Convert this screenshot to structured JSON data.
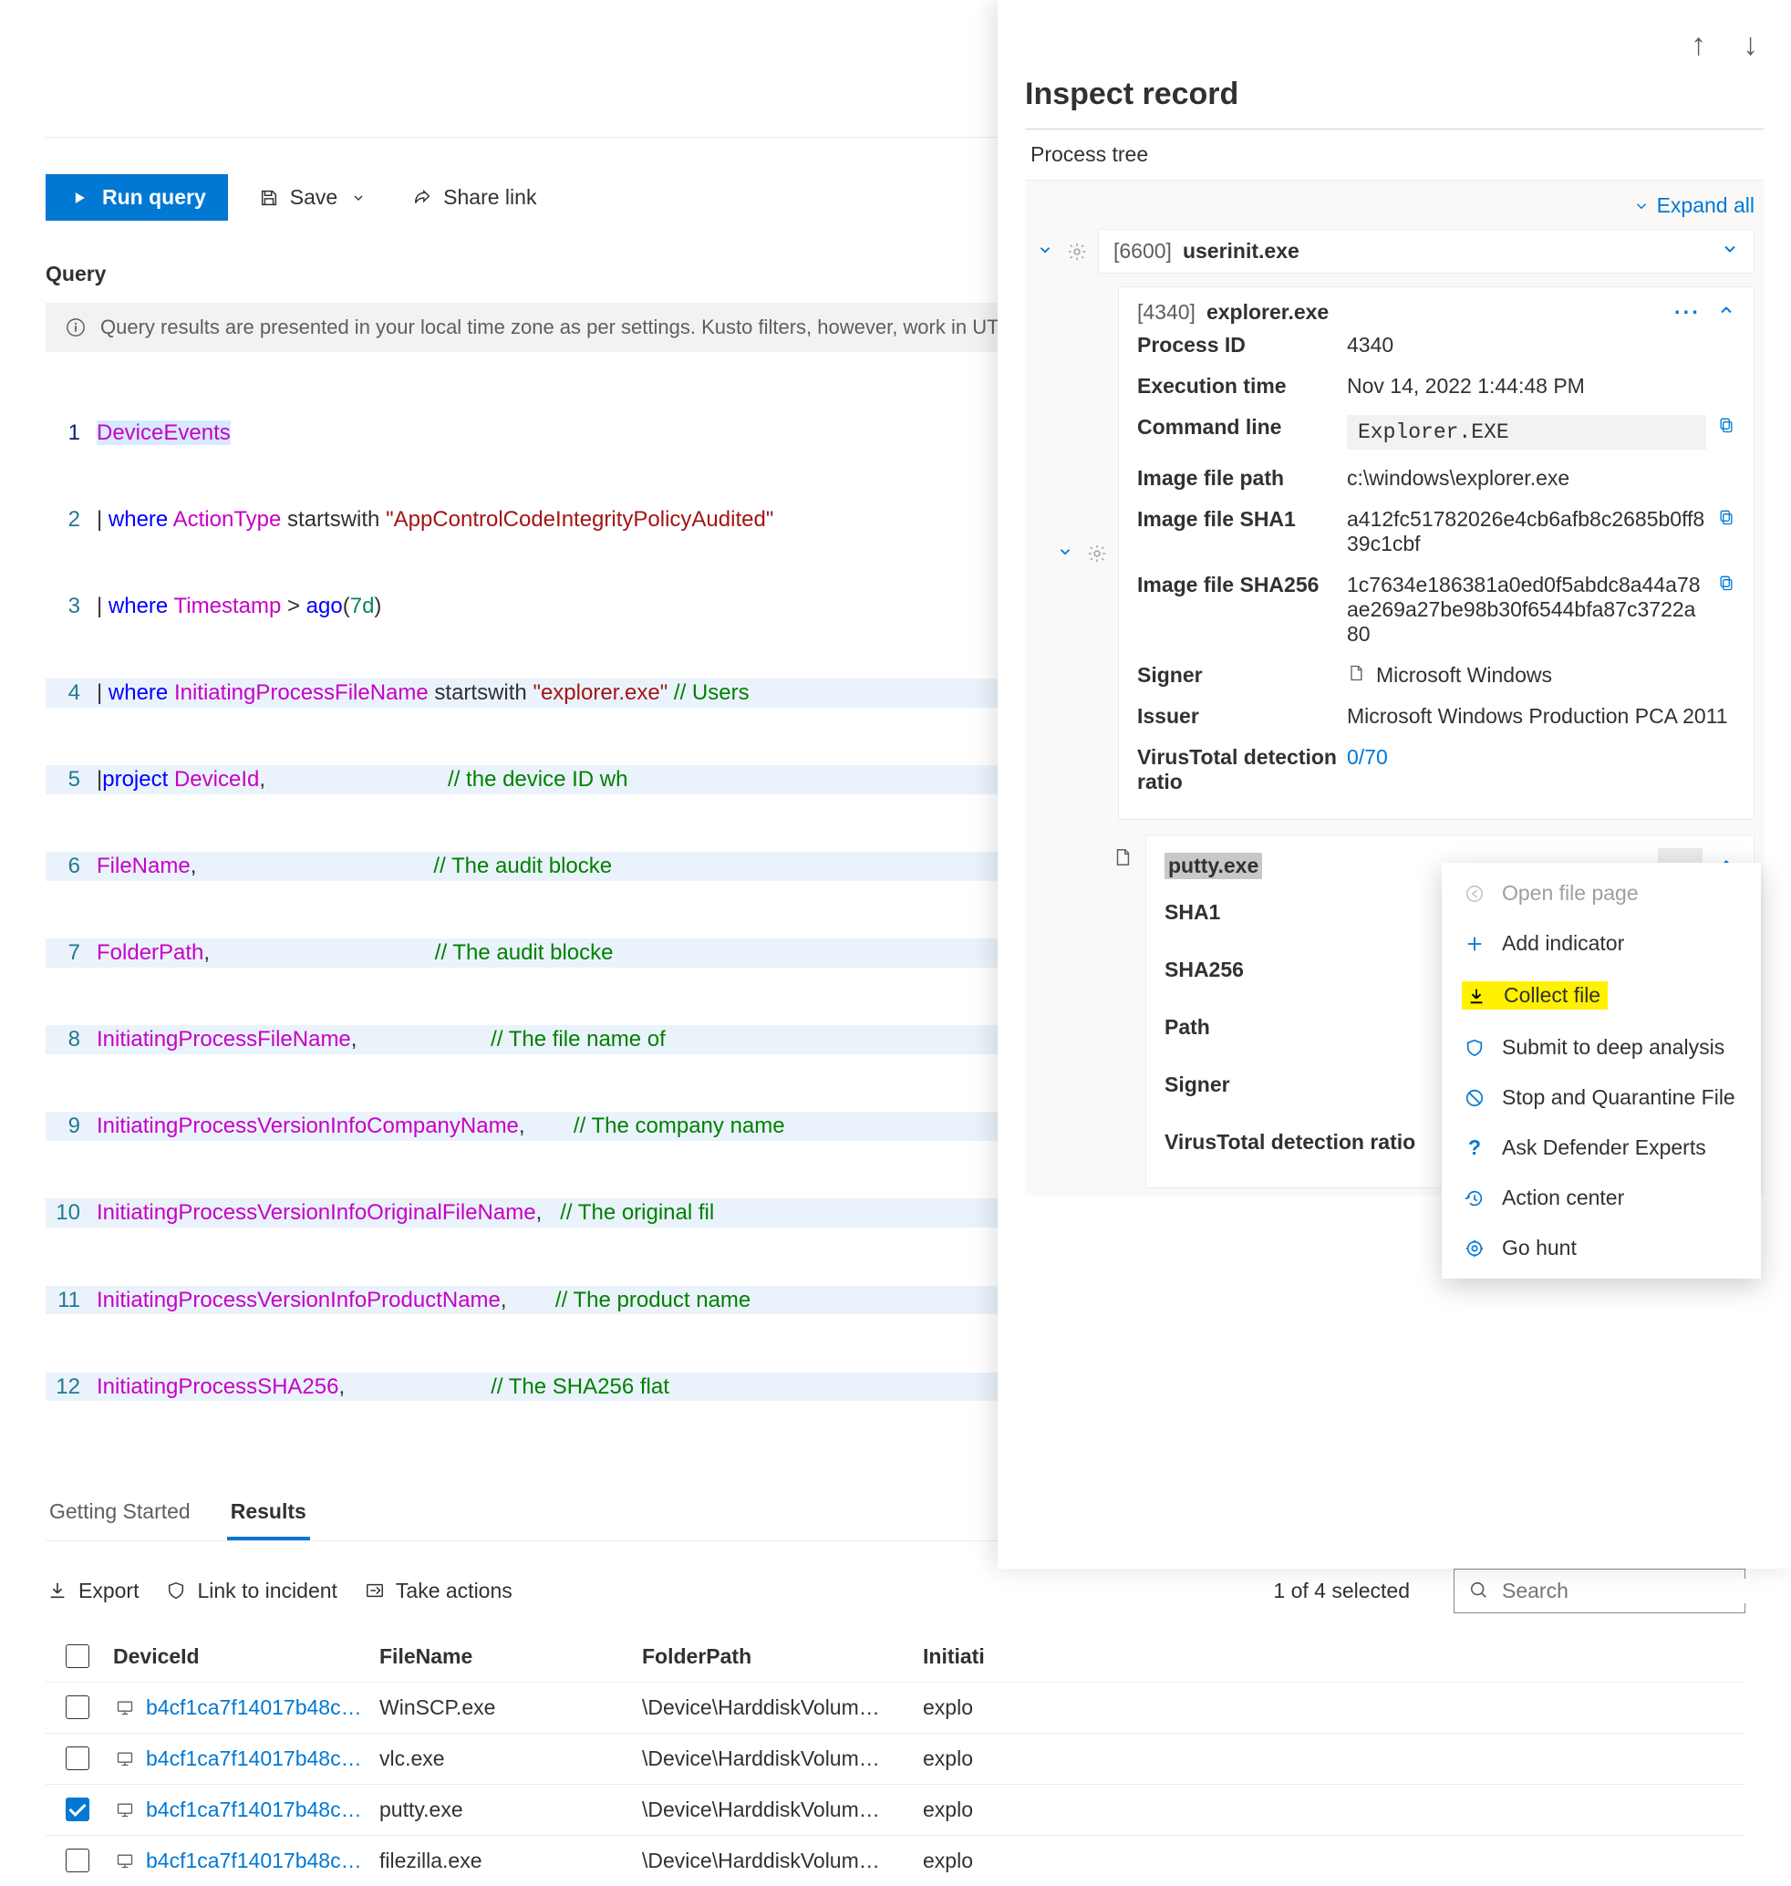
{
  "toolbar": {
    "run": "Run query",
    "save": "Save",
    "share": "Share link"
  },
  "query_label": "Query",
  "info_bar": "Query results are presented in your local time zone as per settings. Kusto filters, however, work in UTC.",
  "code": {
    "lines": [
      "DeviceEvents",
      "| where ActionType startswith \"AppControlCodeIntegrityPolicyAudited\"",
      "| where Timestamp > ago(7d)",
      "| where InitiatingProcessFileName startswith \"explorer.exe\" // Users",
      "|project DeviceId,                              // the device ID wh",
      "FileName,                                       // The audit blocke",
      "FolderPath,                                     // The audit blocke",
      "InitiatingProcessFileName,                      // The file name of",
      "InitiatingProcessVersionInfoCompanyName,        // The company name",
      "InitiatingProcessVersionInfoOriginalFileName,   // The original fil",
      "InitiatingProcessVersionInfoProductName,        // The product name",
      "InitiatingProcessSHA256,                        // The SHA256 flat "
    ]
  },
  "tabs": {
    "getting_started": "Getting Started",
    "results": "Results"
  },
  "results_toolbar": {
    "export": "Export",
    "link_incident": "Link to incident",
    "take_actions": "Take actions",
    "selected": "1 of 4 selected",
    "search_placeholder": "Search"
  },
  "table": {
    "headers": {
      "device": "DeviceId",
      "file": "FileName",
      "folder": "FolderPath",
      "init": "Initiati"
    },
    "rows": [
      {
        "selected": false,
        "device": "b4cf1ca7f14017b48c…",
        "file": "WinSCP.exe",
        "folder": "\\Device\\HarddiskVolum…",
        "init": "explo"
      },
      {
        "selected": false,
        "device": "b4cf1ca7f14017b48c…",
        "file": "vlc.exe",
        "folder": "\\Device\\HarddiskVolum…",
        "init": "explo"
      },
      {
        "selected": true,
        "device": "b4cf1ca7f14017b48c…",
        "file": "putty.exe",
        "folder": "\\Device\\HarddiskVolum…",
        "init": "explo"
      },
      {
        "selected": false,
        "device": "b4cf1ca7f14017b48c…",
        "file": "filezilla.exe",
        "folder": "\\Device\\HarddiskVolum…",
        "init": "explo"
      }
    ]
  },
  "flyout": {
    "title": "Inspect record",
    "section": "Process tree",
    "expand_all": "Expand all",
    "nodes": {
      "root": {
        "pid": "[6600]",
        "name": "userinit.exe"
      },
      "child": {
        "pid": "[4340]",
        "name": "explorer.exe"
      }
    },
    "details": {
      "process_id": {
        "k": "Process ID",
        "v": "4340"
      },
      "exec_time": {
        "k": "Execution time",
        "v": "Nov 14, 2022 1:44:48 PM"
      },
      "cmdline": {
        "k": "Command line",
        "v": "Explorer.EXE"
      },
      "img_path": {
        "k": "Image file path",
        "v": "c:\\windows\\explorer.exe"
      },
      "sha1": {
        "k": "Image file SHA1",
        "v": "a412fc51782026e4cb6afb8c2685b0ff839c1cbf"
      },
      "sha256": {
        "k": "Image file SHA256",
        "v": "1c7634e186381a0ed0f5abdc8a44a78ae269a27be98b30f6544bfa87c3722a80"
      },
      "signer": {
        "k": "Signer",
        "v": "Microsoft Windows"
      },
      "issuer": {
        "k": "Issuer",
        "v": "Microsoft Windows Production PCA 2011"
      },
      "vt": {
        "k": "VirusTotal detection ratio",
        "v": "0/70"
      }
    },
    "file": {
      "name": "putty.exe",
      "rows": {
        "sha1": "SHA1",
        "sha256": "SHA256",
        "path": "Path",
        "signer": "Signer",
        "vt": "VirusTotal detection ratio"
      }
    },
    "menu": {
      "open_file_page": "Open file page",
      "add_indicator": "Add indicator",
      "collect_file": "Collect file",
      "deep_analysis": "Submit to deep analysis",
      "stop_quarantine": "Stop and Quarantine File",
      "ask_experts": "Ask Defender Experts",
      "action_center": "Action center",
      "go_hunt": "Go hunt"
    }
  }
}
